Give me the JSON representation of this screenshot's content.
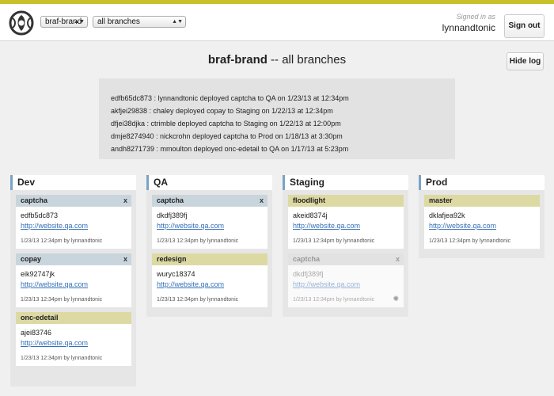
{
  "header": {
    "repo_select": "braf-brand",
    "branch_select": "all branches",
    "signed_in_label": "Signed in as",
    "username": "lynnandtonic",
    "signout_label": "Sign out"
  },
  "main": {
    "title_bold": "braf-brand",
    "title_rest": " -- all branches",
    "hide_log_label": "Hide log"
  },
  "log": [
    "edfb65dc873 : lynnandtonic deployed captcha to QA on 1/23/13 at 12:34pm",
    "akfjei29838 : chaley deployed copay to Staging on 1/22/13 at 12:34pm",
    "dfjei38djka : ctrimble deployed captcha to Staging on 1/22/13 at 12:00pm",
    "dmje8274940 : nickcrohn deployed captcha to Prod on 1/18/13 at 3:30pm",
    "andh8271739 : mmoulton deployed onc-edetail to QA on 1/17/13 at 5:23pm"
  ],
  "columns": [
    {
      "name": "Dev",
      "cards": [
        {
          "branch": "captcha",
          "hash": "edfb5dc873",
          "link": "http://website.qa.com",
          "meta": "1/23/13 12:34pm by lynnandtonic",
          "close": "x"
        },
        {
          "branch": "copay",
          "hash": "eik92747jk",
          "link": "http://website.qa.com",
          "meta": "1/23/13 12:34pm by lynnandtonic",
          "close": "x"
        },
        {
          "branch": "onc-edetail",
          "hash": "ajei83746",
          "link": "http://website.qa.com",
          "meta": "1/23/13 12:34pm by lynnandtonic"
        }
      ]
    },
    {
      "name": "QA",
      "cards": [
        {
          "branch": "captcha",
          "hash": "dkdfj389fj",
          "link": "http://website.qa.com",
          "meta": "1/23/13 12:34pm by lynnandtonic",
          "close": "x"
        },
        {
          "branch": "redesign",
          "hash": "wuryc18374",
          "link": "http://website.qa.com",
          "meta": "1/23/13 12:34pm by lynnandtonic"
        }
      ]
    },
    {
      "name": "Staging",
      "cards": [
        {
          "branch": "floodlight",
          "hash": "akeid8374j",
          "link": "http://website.qa.com",
          "meta": "1/23/13 12:34pm by lynnandtonic"
        },
        {
          "branch": "captcha",
          "hash": "dkdfj389fj",
          "link": "http://website.qa.com",
          "meta": "1/23/13 12:34pm by lynnandtonic",
          "close": "x"
        }
      ]
    },
    {
      "name": "Prod",
      "cards": [
        {
          "branch": "master",
          "hash": "dklafjea92k",
          "link": "http://website.qa.com",
          "meta": "1/23/13 12:34pm by lynnandtonic"
        }
      ]
    }
  ],
  "icons": {
    "logo": "app-logo-icon",
    "close": "close-icon",
    "dropdown": "chevron-updown-icon",
    "spinner": "loading-spinner-icon"
  },
  "colors": {
    "accent_stripe": "#c9c12a",
    "column_border": "#7ba4c4",
    "card_head_blue": "#c9d5dd",
    "card_head_yellow": "#ddd9a3",
    "link": "#3670b8"
  }
}
